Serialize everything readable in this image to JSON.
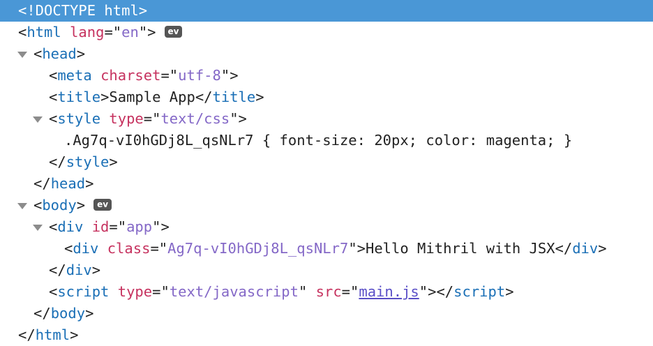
{
  "doctype": "<!DOCTYPE html>",
  "html_open": {
    "tag": "html",
    "attr": "lang",
    "value": "en",
    "badge": "ev"
  },
  "head_open": {
    "tag": "head"
  },
  "meta": {
    "tag": "meta",
    "attr": "charset",
    "value": "utf-8"
  },
  "title": {
    "tag": "title",
    "text": "Sample App"
  },
  "style_open": {
    "tag": "style",
    "attr": "type",
    "value": "text/css"
  },
  "css_text": ".Ag7q-vI0hGDj8L_qsNLr7 { font-size: 20px; color: magenta; }",
  "style_close": {
    "tag": "style"
  },
  "head_close": {
    "tag": "head"
  },
  "body_open": {
    "tag": "body",
    "badge": "ev"
  },
  "div_app": {
    "tag": "div",
    "attr": "id",
    "value": "app"
  },
  "div_inner": {
    "tag": "div",
    "attr": "class",
    "value": "Ag7q-vI0hGDj8L_qsNLr7",
    "text": "Hello Mithril with JSX"
  },
  "div_close": {
    "tag": "div"
  },
  "script": {
    "tag": "script",
    "attr1": "type",
    "value1": "text/javascript",
    "attr2": "src",
    "value2": "main.js"
  },
  "body_close": {
    "tag": "body"
  },
  "html_close": {
    "tag": "html"
  },
  "colors": {
    "selection": "#4a97d6",
    "tag": "#1a6fb6",
    "attribute": "#c6325f",
    "value": "#8468c7",
    "badge": "#555555"
  }
}
